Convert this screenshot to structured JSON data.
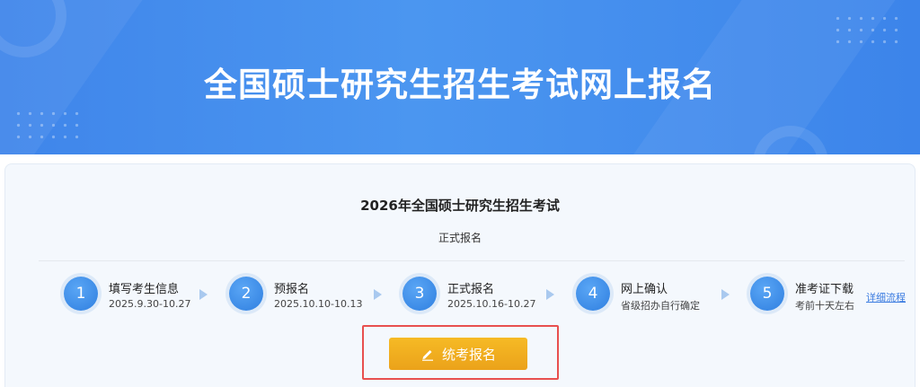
{
  "banner": {
    "title": "全国硕士研究生招生考试网上报名"
  },
  "exam": {
    "title": "2026年全国硕士研究生招生考试",
    "subtitle": "正式报名"
  },
  "steps": [
    {
      "num": "1",
      "name": "填写考生信息",
      "date": "2025.9.30-10.27"
    },
    {
      "num": "2",
      "name": "预报名",
      "date": "2025.10.10-10.13"
    },
    {
      "num": "3",
      "name": "正式报名",
      "date": "2025.10.16-10.27"
    },
    {
      "num": "4",
      "name": "网上确认",
      "date": "省级招办自行确定"
    },
    {
      "num": "5",
      "name": "准考证下载",
      "date": "考前十天左右"
    }
  ],
  "detail_link": "详细流程",
  "register_button": {
    "label": "统考报名",
    "icon": "pencil-icon"
  },
  "colors": {
    "banner": "#4790ee",
    "accent": "#2f7fe0",
    "button": "#f0ab1f",
    "highlight": "#e8504f"
  }
}
